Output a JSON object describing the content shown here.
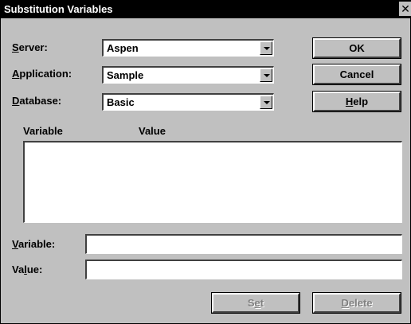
{
  "window": {
    "title": "Substitution Variables",
    "close_glyph": "✕"
  },
  "selectors": {
    "server": {
      "label_key": "S",
      "label_rest": "erver:",
      "value": "Aspen"
    },
    "application": {
      "label_key": "A",
      "label_rest": "pplication:",
      "value": "Sample"
    },
    "database": {
      "label_key": "D",
      "label_rest": "atabase:",
      "value": "Basic"
    }
  },
  "buttons": {
    "ok": "OK",
    "cancel": "Cancel",
    "help_key": "H",
    "help_rest": "elp",
    "set_pre": "S",
    "set_key": "e",
    "set_post": "t",
    "delete_key": "D",
    "delete_rest": "elete"
  },
  "list": {
    "columns": [
      "Variable",
      "Value"
    ],
    "rows": []
  },
  "inputs": {
    "variable": {
      "label_key": "V",
      "label_rest": "ariable:",
      "value": ""
    },
    "value": {
      "label_pre": "Va",
      "label_key": "l",
      "label_post": "ue:",
      "value": ""
    }
  },
  "icons": {
    "dropdown": "chevron-down-icon",
    "close": "close-icon"
  }
}
